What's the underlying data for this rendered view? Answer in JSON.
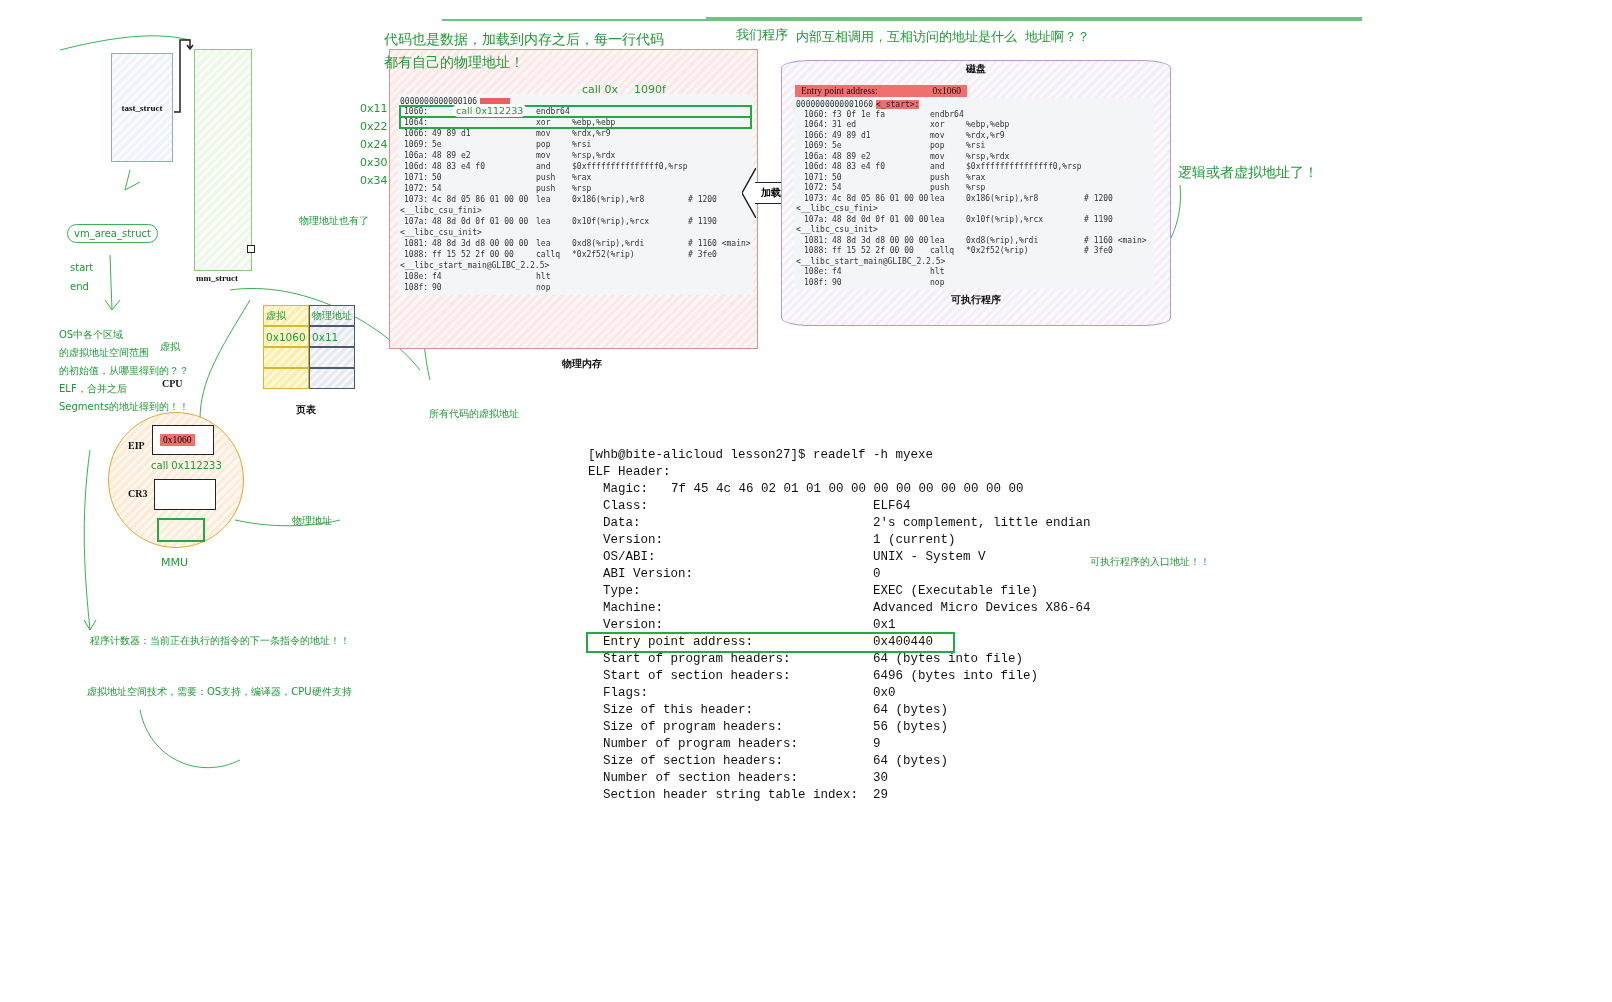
{
  "task_struct": {
    "label": "tast_struct"
  },
  "mm_struct": {
    "label": "mm_struct"
  },
  "vm_area": {
    "label": "vm_area_struct",
    "fields": [
      "start",
      "end"
    ]
  },
  "notes": [
    "代码也是数据，加载到内存之后，每一行代码",
    "都有自己的物理地址！",
    "我们程序",
    "内部互相调用，互相访问的地址是什么  地址啊？？",
    "逻辑或者虚拟地址了！",
    "物理地址也有了",
    "OS中各个区域",
    "的虚拟地址空间范围",
    "的初始值，从哪里得到的？？",
    "ELF，合并之后",
    "Segments的地址得到的！！",
    "虚拟",
    "所有代码的虚拟地址",
    "物理地址",
    "MMU",
    "程序计数器：当前正在执行的指令的下一条指令的地址！！",
    "虚拟地址空间技术，需要：OS支持，编译器，CPU硬件支持",
    "可执行程序的入口地址！！",
    "call 0x",
    "1090f"
  ],
  "memory_panel": {
    "caption": "物理内存",
    "addresses": [
      "0x11",
      "0x22",
      "0x24",
      "0x30",
      "0x34"
    ],
    "call_note": "call 0x112233",
    "header": {
      "address": "0000000000000106",
      "highlighted": true
    },
    "rows": [
      {
        "kind": "instr",
        "addr": "1060:",
        "op": "endbr64",
        "boxed": true
      },
      {
        "kind": "instr",
        "addr": "1064:",
        "op": "xor",
        "args": "%ebp,%ebp",
        "boxed": true
      },
      {
        "kind": "instr",
        "addr": "1066:",
        "bytes": "49 89 d1",
        "op": "mov",
        "args": "%rdx,%r9",
        "boxed": false
      },
      {
        "kind": "instr",
        "addr": "1069:",
        "bytes": "5e",
        "op": "pop",
        "args": "%rsi",
        "boxed": false
      },
      {
        "kind": "instr",
        "addr": "106a:",
        "bytes": "48 89 e2",
        "op": "mov",
        "args": "%rsp,%rdx",
        "boxed": false
      },
      {
        "kind": "instr",
        "addr": "106d:",
        "bytes": "48 83 e4 f0",
        "op": "and",
        "args": "$0xfffffffffffffff0,%rsp",
        "boxed": false
      },
      {
        "kind": "instr",
        "addr": "1071:",
        "bytes": "50",
        "op": "push",
        "args": "%rax",
        "boxed": false
      },
      {
        "kind": "instr",
        "addr": "1072:",
        "bytes": "54",
        "op": "push",
        "args": "%rsp",
        "boxed": false
      },
      {
        "kind": "instr",
        "addr": "1073:",
        "bytes": "4c 8d 05 86 01 00 00",
        "op": "lea",
        "args": "0x186(%rip),%r8",
        "comment": "# 1200",
        "boxed": false
      },
      {
        "kind": "symbol",
        "text": "<__libc_csu_fini>",
        "boxed": false
      },
      {
        "kind": "instr",
        "addr": "107a:",
        "bytes": "48 8d 0d 0f 01 00 00",
        "op": "lea",
        "args": "0x10f(%rip),%rcx",
        "comment": "# 1190",
        "boxed": false
      },
      {
        "kind": "symbol",
        "text": "<__libc_csu_init>",
        "boxed": false
      },
      {
        "kind": "instr",
        "addr": "1081:",
        "bytes": "48 8d 3d d8 00 00 00",
        "op": "lea",
        "args": "0xd8(%rip),%rdi",
        "comment": "# 1160 <main>",
        "boxed": false
      },
      {
        "kind": "instr",
        "addr": "1088:",
        "bytes": "ff 15 52 2f 00 00",
        "op": "callq",
        "args": "*0x2f52(%rip)",
        "comment": "# 3fe0",
        "boxed": false
      },
      {
        "kind": "symbol",
        "text": "<__libc_start_main@GLIBC_2.2.5>",
        "boxed": false
      },
      {
        "kind": "instr",
        "addr": "108e:",
        "bytes": "f4",
        "op": "hlt",
        "boxed": false
      },
      {
        "kind": "instr",
        "addr": "108f:",
        "bytes": "90",
        "op": "nop",
        "boxed": false
      }
    ]
  },
  "load_arrow": {
    "label": "加载"
  },
  "disk_panel": {
    "title": "磁盘",
    "caption": "可执行程序",
    "entry": {
      "label": "Entry point address:",
      "value": "0x1060",
      "highlighted": true
    },
    "header": {
      "address": "0000000000001060",
      "symbol": "<_start>:",
      "highlighted": true
    },
    "rows": [
      {
        "kind": "instr",
        "addr": "1060:",
        "bytes": "f3 0f 1e fa",
        "op": "endbr64"
      },
      {
        "kind": "instr",
        "addr": "1064:",
        "bytes": "31 ed",
        "op": "xor",
        "args": "%ebp,%ebp"
      },
      {
        "kind": "instr",
        "addr": "1066:",
        "bytes": "49 89 d1",
        "op": "mov",
        "args": "%rdx,%r9"
      },
      {
        "kind": "instr",
        "addr": "1069:",
        "bytes": "5e",
        "op": "pop",
        "args": "%rsi"
      },
      {
        "kind": "instr",
        "addr": "106a:",
        "bytes": "48 89 e2",
        "op": "mov",
        "args": "%rsp,%rdx"
      },
      {
        "kind": "instr",
        "addr": "106d:",
        "bytes": "48 83 e4 f0",
        "op": "and",
        "args": "$0xfffffffffffffff0,%rsp"
      },
      {
        "kind": "instr",
        "addr": "1071:",
        "bytes": "50",
        "op": "push",
        "args": "%rax"
      },
      {
        "kind": "instr",
        "addr": "1072:",
        "bytes": "54",
        "op": "push",
        "args": "%rsp"
      },
      {
        "kind": "instr",
        "addr": "1073:",
        "bytes": "4c 8d 05 86 01 00 00",
        "op": "lea",
        "args": "0x186(%rip),%r8",
        "comment": "# 1200"
      },
      {
        "kind": "symbol",
        "text": "<__libc_csu_fini>"
      },
      {
        "kind": "instr",
        "addr": "107a:",
        "bytes": "48 8d 0d 0f 01 00 00",
        "op": "lea",
        "args": "0x10f(%rip),%rcx",
        "comment": "# 1190"
      },
      {
        "kind": "symbol",
        "text": "<__libc_csu_init>"
      },
      {
        "kind": "instr",
        "addr": "1081:",
        "bytes": "48 8d 3d d8 00 00 00",
        "op": "lea",
        "args": "0xd8(%rip),%rdi",
        "comment": "# 1160 <main>"
      },
      {
        "kind": "instr",
        "addr": "1088:",
        "bytes": "ff 15 52 2f 00 00",
        "op": "callq",
        "args": "*0x2f52(%rip)",
        "comment": "# 3fe0"
      },
      {
        "kind": "symbol",
        "text": "<__libc_start_main@GLIBC_2.2.5>"
      },
      {
        "kind": "instr",
        "addr": "108e:",
        "bytes": "f4",
        "op": "hlt"
      },
      {
        "kind": "instr",
        "addr": "108f:",
        "bytes": "90",
        "op": "nop"
      }
    ]
  },
  "page_table": {
    "caption": "页表",
    "header": [
      "虚拟",
      "物理地址"
    ],
    "rows": [
      [
        "0x1060",
        "0x11"
      ]
    ]
  },
  "cpu": {
    "label": "CPU",
    "eip_label": "EIP",
    "eip_value": "0x1060",
    "eip_highlighted": true,
    "call_note": "call 0x112233",
    "cr3_label": "CR3"
  },
  "terminal": {
    "prompt": "[whb@bite-alicloud lesson27]$ readelf -h myexe",
    "heading": "ELF Header:",
    "magic_label": "Magic:",
    "magic_value": "7f 45 4c 46 02 01 01 00 00 00 00 00 00 00 00 00",
    "fields": [
      {
        "key": "Class:",
        "value": "ELF64",
        "highlighted": false
      },
      {
        "key": "Data:",
        "value": "2's complement, little endian",
        "highlighted": false
      },
      {
        "key": "Version:",
        "value": "1 (current)",
        "highlighted": false
      },
      {
        "key": "OS/ABI:",
        "value": "UNIX - System V",
        "highlighted": false
      },
      {
        "key": "ABI Version:",
        "value": "0",
        "highlighted": false
      },
      {
        "key": "Type:",
        "value": "EXEC (Executable file)",
        "highlighted": false
      },
      {
        "key": "Machine:",
        "value": "Advanced Micro Devices X86-64",
        "highlighted": false
      },
      {
        "key": "Version:",
        "value": "0x1",
        "highlighted": false
      },
      {
        "key": "Entry point address:",
        "value": "0x400440",
        "highlighted": true
      },
      {
        "key": "Start of program headers:",
        "value": "64 (bytes into file)",
        "highlighted": false
      },
      {
        "key": "Start of section headers:",
        "value": "6496 (bytes into file)",
        "highlighted": false
      },
      {
        "key": "Flags:",
        "value": "0x0",
        "highlighted": false
      },
      {
        "key": "Size of this header:",
        "value": "64 (bytes)",
        "highlighted": false
      },
      {
        "key": "Size of program headers:",
        "value": "56 (bytes)",
        "highlighted": false
      },
      {
        "key": "Number of program headers:",
        "value": "9",
        "highlighted": false
      },
      {
        "key": "Size of section headers:",
        "value": "64 (bytes)",
        "highlighted": false
      },
      {
        "key": "Number of section headers:",
        "value": "30",
        "highlighted": false
      },
      {
        "key": "Section header string table index:",
        "value": "29",
        "highlighted": false
      }
    ]
  }
}
